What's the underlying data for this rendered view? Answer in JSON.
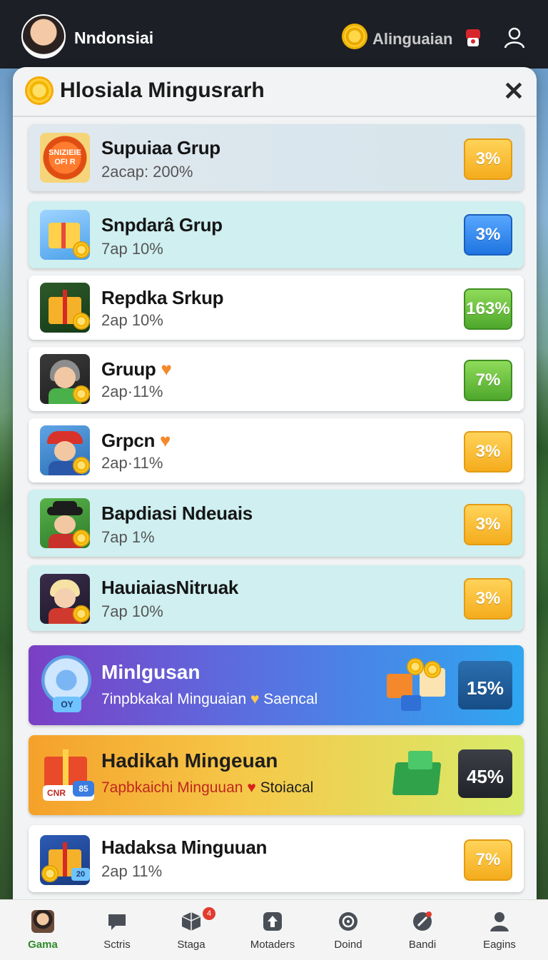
{
  "header": {
    "username": "Nndonsiai",
    "coin_label": "Alinguaian"
  },
  "modal": {
    "title": "Hlosiala Mingusrarh",
    "close_symbol": "✕"
  },
  "rows": [
    {
      "title": "Supuiaa Grup",
      "subtitle": "2acap: 200%",
      "badge": "3%",
      "thumb_text": "SNIZIEIE OFI R",
      "icon": "sale-badge-icon"
    },
    {
      "title": "Snpdarâ Grup",
      "subtitle": "7ap 10%",
      "badge": "3%",
      "icon": "gift-box-icon"
    },
    {
      "title": "Repdka Srkup",
      "subtitle": "2ap 10%",
      "badge": "163%",
      "icon": "present-icon"
    },
    {
      "title": "Gruup",
      "subtitle": "2ap·11%",
      "badge": "7%",
      "icon": "avatar-gray-hair-icon"
    },
    {
      "title": "Grpcn",
      "subtitle": "2ap·11%",
      "badge": "3%",
      "icon": "avatar-red-hat-icon"
    },
    {
      "title": "Bapdiasi Ndeuais",
      "subtitle": "7ap 1%",
      "badge": "3%",
      "icon": "avatar-black-hat-icon"
    },
    {
      "title": "HauiaiasNitruak",
      "subtitle": "7ap 10%",
      "badge": "3%",
      "icon": "avatar-blonde-icon"
    }
  ],
  "promo1": {
    "title": "Minlgusan",
    "subtitle_a": "7inpbkakal Minguaian",
    "subtitle_b": "Saencal",
    "badge": "15%",
    "tag": "OY"
  },
  "promo2": {
    "title": "Hadikah Mingeuan",
    "subtitle_a": "7apbkaichi Minguuan",
    "subtitle_b": "Stoiacal",
    "badge": "45%",
    "tag": "CNR",
    "tag2": "85"
  },
  "last_row": {
    "title": "Hadaksa Minguuan",
    "subtitle": "2ap 11%",
    "badge": "7%",
    "tag": "20"
  },
  "nav": [
    {
      "label": "Gama",
      "icon": "avatar-icon",
      "active": true
    },
    {
      "label": "Sctris",
      "icon": "chat-icon"
    },
    {
      "label": "Staga",
      "icon": "box-icon",
      "badge": "4"
    },
    {
      "label": "Motaders",
      "icon": "upload-icon"
    },
    {
      "label": "Doind",
      "icon": "target-icon"
    },
    {
      "label": "Bandi",
      "icon": "map-pin-icon"
    },
    {
      "label": "Eagins",
      "icon": "profile-icon"
    }
  ]
}
